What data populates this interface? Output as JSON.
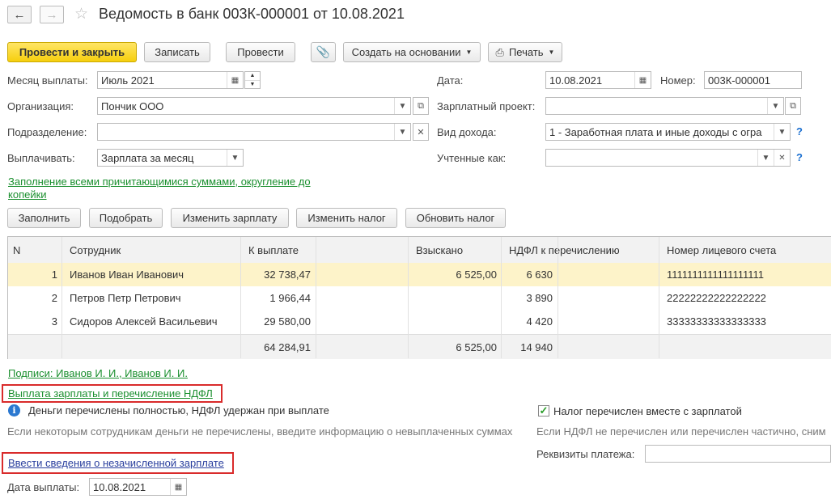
{
  "header": {
    "title": "Ведомость в банк 003К-000001 от 10.08.2021"
  },
  "toolbar": {
    "post_close": "Провести и закрыть",
    "save": "Записать",
    "post": "Провести",
    "create_based": "Создать на основании",
    "print": "Печать"
  },
  "form": {
    "month_label": "Месяц выплаты:",
    "month_value": "Июль 2021",
    "date_label": "Дата:",
    "date_value": "10.08.2021",
    "number_label": "Номер:",
    "number_value": "003К-000001",
    "org_label": "Организация:",
    "org_value": "Пончик ООО",
    "salary_project_label": "Зарплатный проект:",
    "salary_project_value": "",
    "dept_label": "Подразделение:",
    "dept_value": "",
    "income_type_label": "Вид дохода:",
    "income_type_value": "1 - Заработная плата и иные доходы с огра",
    "pay_label": "Выплачивать:",
    "pay_value": "Зарплата за месяц",
    "counted_label": "Учтенные как:",
    "counted_value": "",
    "fill_link_line1": "Заполнение всеми причитающимися суммами, округление до",
    "fill_link_line2": "копейки"
  },
  "actions": {
    "fill": "Заполнить",
    "pick": "Подобрать",
    "change_salary": "Изменить зарплату",
    "change_tax": "Изменить налог",
    "update_tax": "Обновить налог"
  },
  "table": {
    "headers": [
      "N",
      "Сотрудник",
      "К выплате",
      "Взыскано",
      "НДФЛ к перечислению",
      "Номер лицевого счета"
    ],
    "rows": [
      [
        "1",
        "Иванов Иван Иванович",
        "32 738,47",
        "6 525,00",
        "6 630",
        "1111111111111111111"
      ],
      [
        "2",
        "Петров Петр Петрович",
        "1 966,44",
        "",
        "3 890",
        "22222222222222222"
      ],
      [
        "3",
        "Сидоров Алексей Васильевич",
        "29 580,00",
        "",
        "4 420",
        "33333333333333333"
      ]
    ],
    "totals": [
      "",
      "",
      "64 284,91",
      "6 525,00",
      "14 940",
      ""
    ]
  },
  "footer": {
    "signatures": "Подписи: Иванов И. И., Иванов И. И.",
    "payout_link": "Выплата зарплаты и перечисление НДФЛ",
    "money_status": "Деньги перечислены  полностью, НДФЛ удержан при выплате",
    "money_hint": "Если некоторым сотрудникам деньги не перечислены, введите информацию о невыплаченных суммах",
    "tax_with_salary": "Налог перечислен вместе с зарплатой",
    "tax_hint": "Если НДФЛ не перечислен или перечислен частично, сним",
    "payment_details_label": "Реквизиты платежа:",
    "unaccrued_link": "Ввести сведения о незачисленной зарплате",
    "pay_date_label": "Дата выплаты:",
    "pay_date_value": "10.08.2021"
  },
  "colors": {
    "primary": "#f6cf0d",
    "selected_row": "#fdf3c9",
    "link_green": "#1a8f2e",
    "highlight_red": "#d92b2b"
  }
}
